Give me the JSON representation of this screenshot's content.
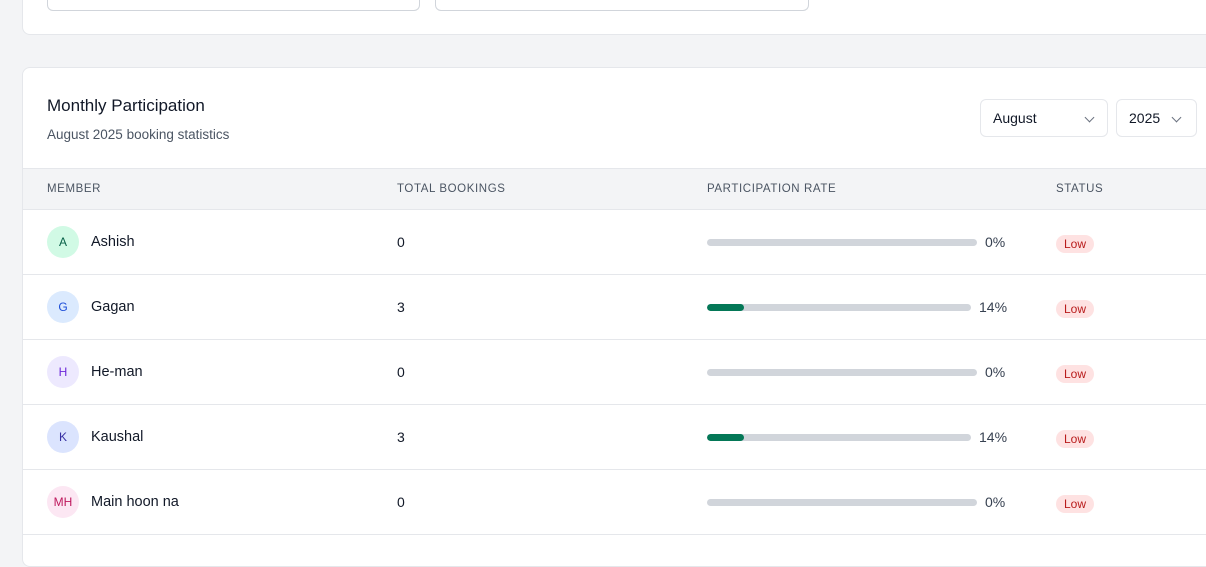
{
  "card": {
    "title": "Monthly Participation",
    "subtitle": "August 2025 booking statistics",
    "month_select": "August",
    "year_select": "2025"
  },
  "table": {
    "headers": {
      "member": "MEMBER",
      "bookings": "TOTAL BOOKINGS",
      "rate": "PARTICIPATION RATE",
      "status": "STATUS"
    },
    "rows": [
      {
        "initials": "A",
        "name": "Ashish",
        "bookings": "0",
        "rate_text": "0%",
        "rate": 0,
        "status": "Low",
        "avatar_bg": "#d1fae5",
        "avatar_fg": "#065f46"
      },
      {
        "initials": "G",
        "name": "Gagan",
        "bookings": "3",
        "rate_text": "14%",
        "rate": 14,
        "status": "Low",
        "avatar_bg": "#dbeafe",
        "avatar_fg": "#1d4ed8"
      },
      {
        "initials": "H",
        "name": "He-man",
        "bookings": "0",
        "rate_text": "0%",
        "rate": 0,
        "status": "Low",
        "avatar_bg": "#ede9fe",
        "avatar_fg": "#6d28d9"
      },
      {
        "initials": "K",
        "name": "Kaushal",
        "bookings": "3",
        "rate_text": "14%",
        "rate": 14,
        "status": "Low",
        "avatar_bg": "#dbe4fe",
        "avatar_fg": "#3730a3"
      },
      {
        "initials": "MH",
        "name": "Main hoon na",
        "bookings": "0",
        "rate_text": "0%",
        "rate": 0,
        "status": "Low",
        "avatar_bg": "#fce7f3",
        "avatar_fg": "#be185d"
      }
    ]
  }
}
